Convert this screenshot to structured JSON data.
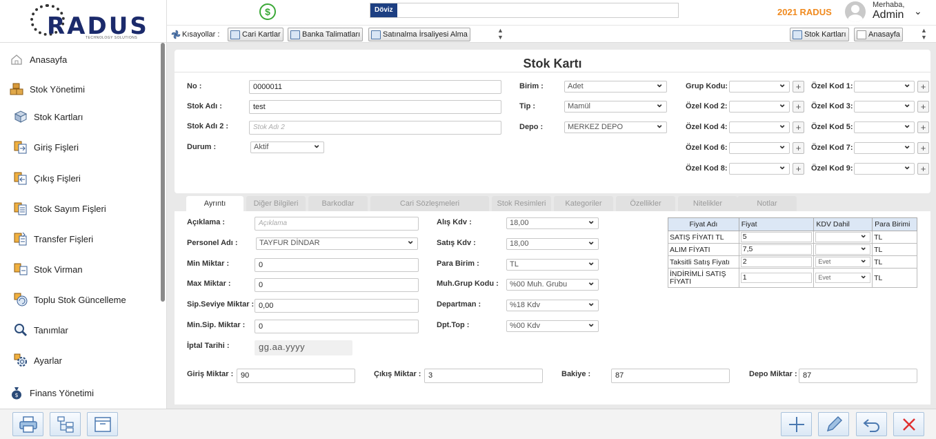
{
  "brand": {
    "name": "RADUS",
    "tagline": "TECHNOLOGY SOLUTIONS"
  },
  "topbar": {
    "currency_icon": "dollar-circle-icon",
    "doviz_label": "Döviz",
    "year_label": "2021 RADUS",
    "greeting": "Merhaba,",
    "user": "Admin"
  },
  "shortcuts": {
    "label": "Kısayollar :",
    "items": [
      "Cari Kartlar",
      "Banka Talimatları",
      "Satınalma İrsaliyesi Alma"
    ],
    "right_items": [
      "Stok Kartları",
      "Anasayfa"
    ]
  },
  "sidebar": {
    "items": [
      {
        "label": "Anasayfa",
        "icon": "home-icon"
      },
      {
        "label": "Stok Yönetimi",
        "icon": "boxes-icon"
      },
      {
        "label": "Stok Kartları",
        "icon": "box-icon"
      },
      {
        "label": "Giriş Fişleri",
        "icon": "doc-in-icon"
      },
      {
        "label": "Çıkış Fişleri",
        "icon": "doc-out-icon"
      },
      {
        "label": "Stok Sayım Fişleri",
        "icon": "count-doc-icon"
      },
      {
        "label": "Transfer Fişleri",
        "icon": "transfer-icon"
      },
      {
        "label": "Stok Virman",
        "icon": "virman-icon"
      },
      {
        "label": "Toplu Stok Güncelleme",
        "icon": "refresh-icon"
      },
      {
        "label": "Tanımlar",
        "icon": "search-icon"
      },
      {
        "label": "Ayarlar",
        "icon": "gear-icon"
      },
      {
        "label": "Finans Yönetimi",
        "icon": "money-bag-icon"
      }
    ]
  },
  "form": {
    "title": "Stok Kartı",
    "no_label": "No :",
    "no_value": "0000011",
    "stok_adi_label": "Stok Adı :",
    "stok_adi_value": "test",
    "stok_adi2_label": "Stok Adı 2 :",
    "stok_adi2_placeholder": "Stok Adı 2",
    "durum_label": "Durum :",
    "durum_value": "Aktif",
    "birim_label": "Birim :",
    "birim_value": "Adet",
    "tip_label": "Tip :",
    "tip_value": "Mamül",
    "depo_label": "Depo :",
    "depo_value": "MERKEZ DEPO",
    "grup_kodu_label": "Grup Kodu:",
    "ozel_kod_labels": [
      "Özel Kod 1:",
      "Özel Kod 2:",
      "Özel Kod 3:",
      "Özel Kod 4:",
      "Özel Kod 5:",
      "Özel Kod 6:",
      "Özel Kod 7:",
      "Özel Kod 8:",
      "Özel Kod 9:"
    ]
  },
  "tabs": [
    "Ayrıntı",
    "Diğer Bilgileri",
    "Barkodlar",
    "Cari Sözleşmeleri",
    "Stok Resimleri",
    "Kategoriler",
    "Özellikler",
    "Nitelikler",
    "Notlar"
  ],
  "detail": {
    "aciklama_label": "Açıklama :",
    "aciklama_placeholder": "Açıklama",
    "personel_label": "Personel Adı :",
    "personel_value": "TAYFUR DİNDAR",
    "min_miktar_label": "Min Miktar :",
    "min_miktar_value": "0",
    "max_miktar_label": "Max Miktar :",
    "max_miktar_value": "0",
    "sip_seviye_label": "Sip.Seviye Miktar :",
    "sip_seviye_value": "0,00",
    "min_sip_label": "Min.Sip. Miktar :",
    "min_sip_value": "0",
    "iptal_label": "İptal Tarihi :",
    "iptal_placeholder": "gg.aa.yyyy",
    "alis_kdv_label": "Alış Kdv :",
    "alis_kdv_value": "18,00",
    "satis_kdv_label": "Satış Kdv :",
    "satis_kdv_value": "18,00",
    "para_birim_label": "Para Birim :",
    "para_birim_value": "TL",
    "muh_grup_label": "Muh.Grup Kodu :",
    "muh_grup_value": "%00 Muh. Grubu",
    "departman_label": "Departman :",
    "departman_value": "%18 Kdv",
    "dpt_top_label": "Dpt.Top :",
    "dpt_top_value": "%00 Kdv",
    "giris_label": "Giriş Miktar :",
    "giris_value": "90",
    "cikis_label": "Çıkış Miktar :",
    "cikis_value": "3",
    "bakiye_label": "Bakiye :",
    "bakiye_value": "87",
    "depo_miktar_label": "Depo Miktar :",
    "depo_miktar_value": "87"
  },
  "price_table": {
    "headers": [
      "Fiyat Adı",
      "Fiyat",
      "KDV Dahil",
      "Para Birimi"
    ],
    "rows": [
      {
        "name": "SATIŞ FİYATI TL",
        "price": "5",
        "kdv": "",
        "currency": "TL"
      },
      {
        "name": "ALIM FİYATI",
        "price": "7,5",
        "kdv": "",
        "currency": "TL"
      },
      {
        "name": "Taksitli Satış Fiyatı",
        "price": "2",
        "kdv": "Evet",
        "currency": "TL"
      },
      {
        "name": "İNDİRİMLİ SATIŞ FİYATI",
        "price": "1",
        "kdv": "Evet",
        "currency": "TL"
      }
    ]
  },
  "bottom_toolbar": {
    "left": [
      "print-icon",
      "tree-icon",
      "archive-icon"
    ],
    "right": [
      "add-icon",
      "edit-icon",
      "undo-icon",
      "close-icon"
    ]
  }
}
